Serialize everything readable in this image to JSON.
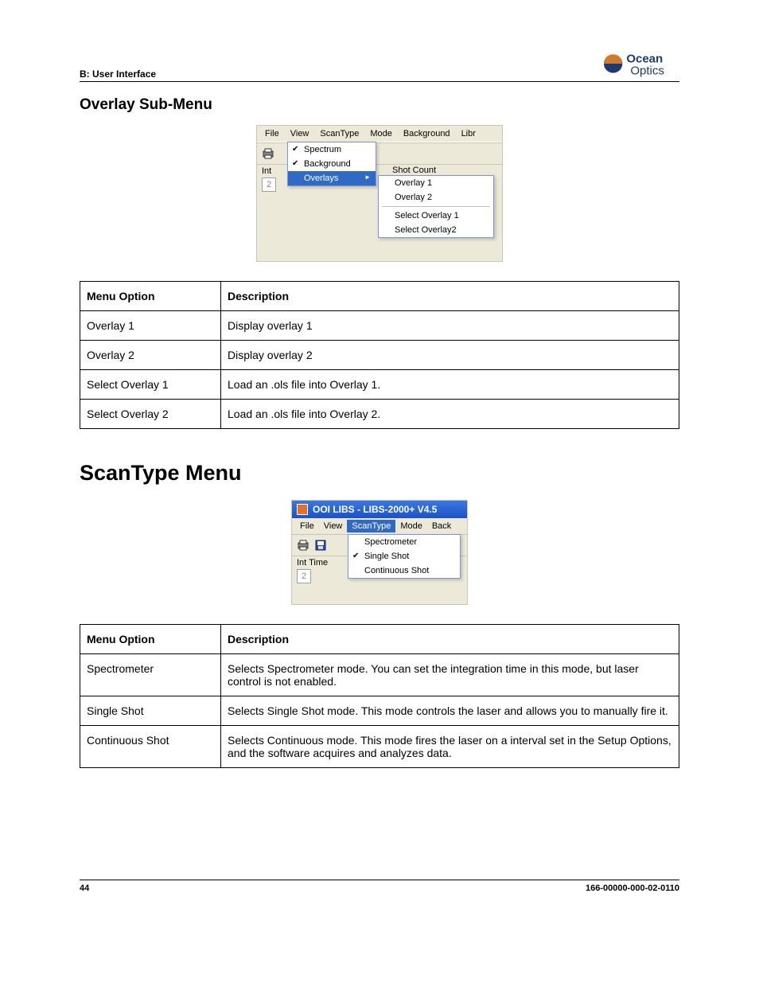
{
  "header": {
    "section_label": "B: User Interface",
    "logo_top": "Ocean",
    "logo_bottom": "Optics"
  },
  "section1": {
    "heading": "Overlay Sub-Menu",
    "menushot": {
      "menubar": [
        "File",
        "View",
        "ScanType",
        "Mode",
        "Background",
        "Libr"
      ],
      "dropdown1": {
        "spectrum": "Spectrum",
        "background": "Background",
        "overlays": "Overlays"
      },
      "toolbar_label": "Int",
      "numbox": "2",
      "shotcount": "Shot Count",
      "submenu": {
        "overlay1": "Overlay 1",
        "overlay2": "Overlay 2",
        "select1": "Select Overlay 1",
        "select2": "Select Overlay2"
      }
    },
    "table": {
      "head_option": "Menu Option",
      "head_desc": "Description",
      "rows": [
        {
          "opt": "Overlay 1",
          "desc": "Display overlay 1"
        },
        {
          "opt": "Overlay 2",
          "desc": "Display overlay 2"
        },
        {
          "opt": "Select Overlay 1",
          "desc": "Load an .ols file into Overlay 1."
        },
        {
          "opt": "Select Overlay 2",
          "desc": "Load an .ols file into Overlay 2."
        }
      ]
    }
  },
  "section2": {
    "heading": "ScanType Menu",
    "menushot": {
      "title": "OOI LIBS - LIBS-2000+ V4.5",
      "menubar": [
        "File",
        "View",
        "ScanType",
        "Mode",
        "Back"
      ],
      "toolbar_label": "Int Time",
      "numbox": "2",
      "dropdown": {
        "spectrometer": "Spectrometer",
        "single_shot": "Single Shot",
        "continuous_shot": "Continuous Shot"
      }
    },
    "table": {
      "head_option": "Menu Option",
      "head_desc": "Description",
      "rows": [
        {
          "opt": "Spectrometer",
          "desc": "Selects Spectrometer mode. You can set the integration time in this mode, but laser control is not enabled."
        },
        {
          "opt": "Single Shot",
          "desc": "Selects Single Shot mode. This mode controls the laser and allows you to manually fire it."
        },
        {
          "opt": "Continuous Shot",
          "desc": "Selects Continuous mode. This mode fires the laser on a interval set in the Setup Options, and the software acquires and analyzes data."
        }
      ]
    }
  },
  "footer": {
    "page": "44",
    "docnum": "166-00000-000-02-0110"
  }
}
